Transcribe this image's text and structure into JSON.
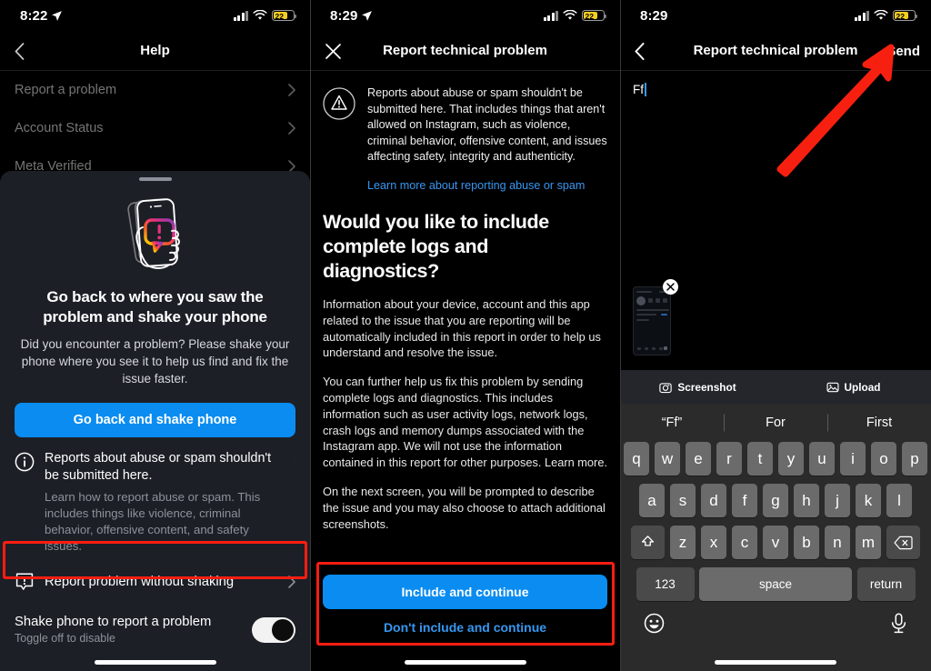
{
  "colors": {
    "accent_blue": "#0a8cf0",
    "link_blue": "#3797f0",
    "highlight_red": "#ff1d12",
    "battery_yellow": "#f5cf1f",
    "sheet_bg": "#1c1f26"
  },
  "panel1": {
    "status": {
      "time": "8:22",
      "battery": "22",
      "location_icon": "location-arrow-icon",
      "wifi_icon": "wifi-icon",
      "signal_icon": "cellular-bars-icon"
    },
    "nav": {
      "title": "Help",
      "back_icon": "chevron-left-icon"
    },
    "list": [
      {
        "label": "Report a problem"
      },
      {
        "label": "Account Status"
      },
      {
        "label": "Meta Verified"
      }
    ],
    "sheet": {
      "illustration": "hand-shaking-phone-illustration",
      "title": "Go back to where you saw the problem and shake your phone",
      "subtitle": "Did you encounter a problem? Please shake your phone where you see it to help us find and fix the issue faster.",
      "cta_label": "Go back and shake phone",
      "info": {
        "icon": "info-circle-icon",
        "title": "Reports about abuse or spam shouldn't be submitted here.",
        "body": "Learn how to report abuse or spam. This includes things like violence, criminal behavior, offensive content, and safety issues."
      },
      "report_without_shaking": {
        "icon": "exclamation-bubble-icon",
        "label": "Report problem without shaking"
      },
      "toggle": {
        "label": "Shake phone to report a problem",
        "sublabel": "Toggle off to disable",
        "state": "on"
      }
    }
  },
  "panel2": {
    "status": {
      "time": "8:29",
      "battery": "22"
    },
    "nav": {
      "title": "Report technical problem",
      "close_icon": "close-x-icon"
    },
    "warning": {
      "icon": "warning-triangle-icon",
      "text": "Reports about abuse or spam shouldn't be submitted here. That includes things that aren't allowed on Instagram, such as violence, criminal behavior, offensive content, and issues affecting safety, integrity and authenticity.",
      "link": "Learn more about reporting abuse or spam"
    },
    "heading": "Would you like to include complete logs and diagnostics?",
    "paragraphs": [
      "Information about your device, account and this app related to the issue that you are reporting will be automatically included in this report in order to help us understand and resolve the issue.",
      "You can further help us fix this problem by sending complete logs and diagnostics. This includes information such as user activity logs, network logs, crash logs and memory dumps associated with the Instagram app. We will not use the information contained in this report for other purposes. Learn more.",
      "On the next screen, you will be prompted to describe the issue and you may also choose to attach additional screenshots."
    ],
    "primary_button": "Include and continue",
    "secondary_button": "Don't include and continue"
  },
  "panel3": {
    "status": {
      "time": "8:29",
      "battery": "22"
    },
    "nav": {
      "title": "Report technical problem",
      "back_icon": "chevron-left-icon",
      "send_label": "Send"
    },
    "compose": {
      "value": "Ff",
      "placeholder": ""
    },
    "attachment": {
      "remove_icon": "close-circle-icon",
      "thumbnail": "screenshot-thumbnail"
    },
    "attach_bar": [
      {
        "label": "Screenshot",
        "icon": "camera-icon"
      },
      {
        "label": "Upload",
        "icon": "photo-icon"
      }
    ],
    "keyboard": {
      "suggestions": [
        "“Ff”",
        "For",
        "First"
      ],
      "row1": [
        "q",
        "w",
        "e",
        "r",
        "t",
        "y",
        "u",
        "i",
        "o",
        "p"
      ],
      "row2": [
        "a",
        "s",
        "d",
        "f",
        "g",
        "h",
        "j",
        "k",
        "l"
      ],
      "row3": [
        "z",
        "x",
        "c",
        "v",
        "b",
        "n",
        "m"
      ],
      "shift_icon": "shift-arrow-icon",
      "backspace_icon": "backspace-icon",
      "numbers_label": "123",
      "space_label": "space",
      "return_label": "return",
      "emoji_icon": "emoji-smiley-icon",
      "mic_icon": "microphone-icon"
    },
    "annotation": {
      "arrow": "red-arrow-pointing-to-send"
    }
  }
}
